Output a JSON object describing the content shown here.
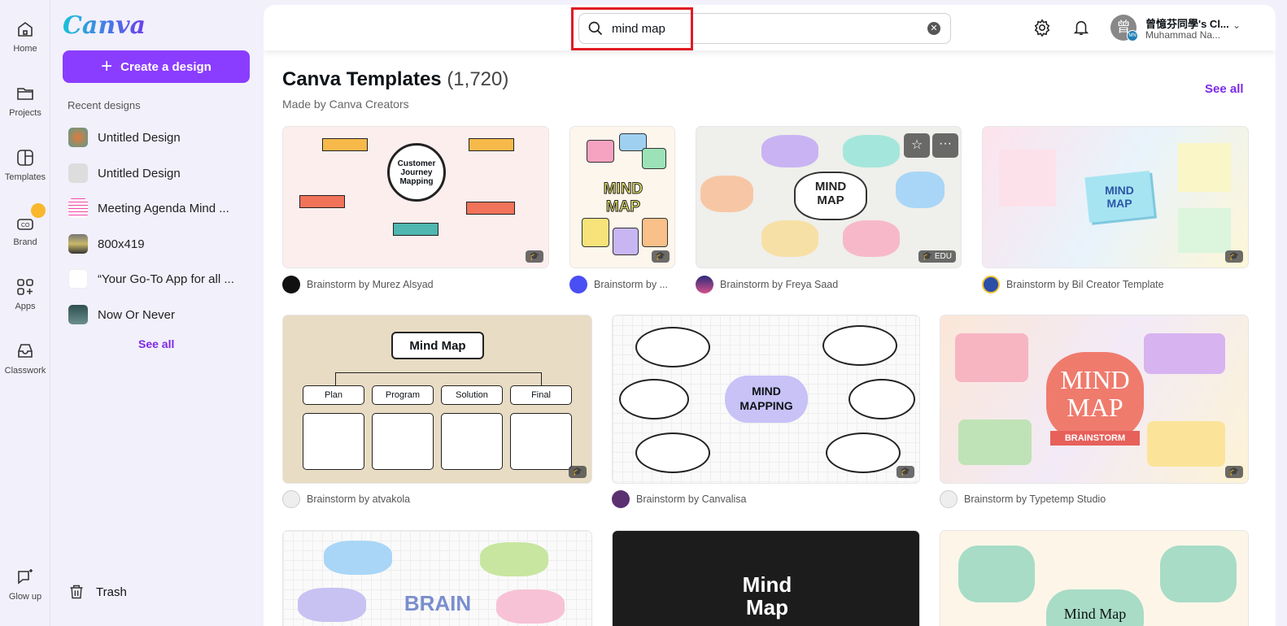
{
  "rail": [
    {
      "label": "Home",
      "icon": "home-icon"
    },
    {
      "label": "Projects",
      "icon": "folder-icon"
    },
    {
      "label": "Templates",
      "icon": "templates-icon"
    },
    {
      "label": "Brand",
      "icon": "brand-icon"
    },
    {
      "label": "Apps",
      "icon": "apps-icon"
    },
    {
      "label": "Classwork",
      "icon": "classwork-icon"
    },
    {
      "label": "Glow up",
      "icon": "glow-up-icon"
    }
  ],
  "panel": {
    "logo": "Canva",
    "create": "Create a design",
    "recent_heading": "Recent designs",
    "recent": [
      "Untitled Design",
      "Untitled Design",
      "Meeting Agenda Mind ...",
      "800x419",
      "“Your Go-To App for all ...",
      "Now Or Never"
    ],
    "see_all": "See all",
    "trash": "Trash"
  },
  "header": {
    "search_value": "mind map",
    "account_name": "曾憶芬同學's Cl...",
    "account_user": "Muhammad Na...",
    "avatar_text": "曾",
    "avatar_badge": "MN"
  },
  "section": {
    "title": "Canva Templates",
    "count": "(1,720)",
    "subtitle": "Made by Canva Creators",
    "see_all": "See all"
  },
  "templates": [
    {
      "caption": "Brainstorm by Murez Alsyad",
      "thumb": "Customer Journey Mapping"
    },
    {
      "caption": "Brainstorm by ...",
      "thumb": "MIND MAP"
    },
    {
      "caption": "Brainstorm by Freya Saad",
      "thumb": "MIND MAP",
      "badge": "EDU"
    },
    {
      "caption": "Brainstorm by Bil Creator Template",
      "thumb": "MIND MAP"
    },
    {
      "caption": "Brainstorm by atvakola",
      "thumb": "Mind Map",
      "boxes": [
        "Plan",
        "Program",
        "Solution",
        "Final"
      ]
    },
    {
      "caption": "Brainstorm by Canvalisa",
      "thumb": "MIND MAPPING"
    },
    {
      "caption": "Brainstorm by Typetemp Studio",
      "thumb": "MIND MAP",
      "sub": "BRAINSTORM"
    },
    {
      "thumb": "BRAIN"
    },
    {
      "thumb": "Mind Map"
    },
    {
      "thumb": "Mind Map"
    }
  ],
  "help": "?",
  "colors": {
    "accent": "#8b3dff",
    "highlight": "#e01b24"
  }
}
